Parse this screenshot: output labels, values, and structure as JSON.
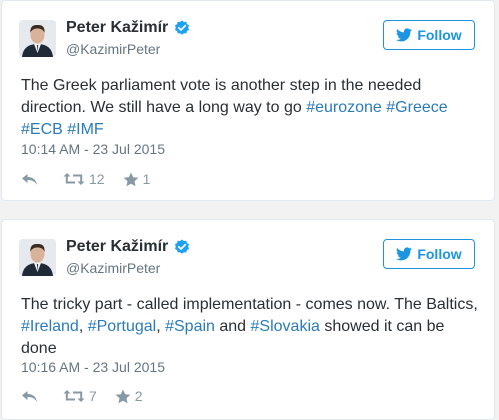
{
  "tweets": [
    {
      "author_name": "Peter Kažimír",
      "handle": "@KazimirPeter",
      "follow_label": "Follow",
      "text_parts": [
        "The Greek parliament vote is another step in the needed direction. We still have a long way to go ",
        "#eurozone",
        " ",
        "#Greece",
        " ",
        "#ECB",
        " ",
        "#IMF"
      ],
      "timestamp": "10:14 AM - 23 Jul 2015",
      "retweets": "12",
      "favorites": "1"
    },
    {
      "author_name": "Peter Kažimír",
      "handle": "@KazimirPeter",
      "follow_label": "Follow",
      "text_parts": [
        "The tricky part - called implementation - comes now. The Baltics, ",
        "#Ireland",
        ", ",
        "#Portugal",
        ", ",
        "#Spain",
        " and ",
        "#Slovakia",
        " showed it can be done"
      ],
      "timestamp": "10:16 AM - 23 Jul 2015",
      "retweets": "7",
      "favorites": "2"
    }
  ],
  "colors": {
    "link": "#2b7bb9",
    "follow": "#1b95e0",
    "verified": "#1da1f2",
    "muted": "#66757f",
    "icon": "#8899a6"
  },
  "icons": {
    "verified": "verified-badge-icon",
    "follow": "twitter-bird-icon",
    "reply": "reply-icon",
    "retweet": "retweet-icon",
    "favorite": "star-icon"
  }
}
